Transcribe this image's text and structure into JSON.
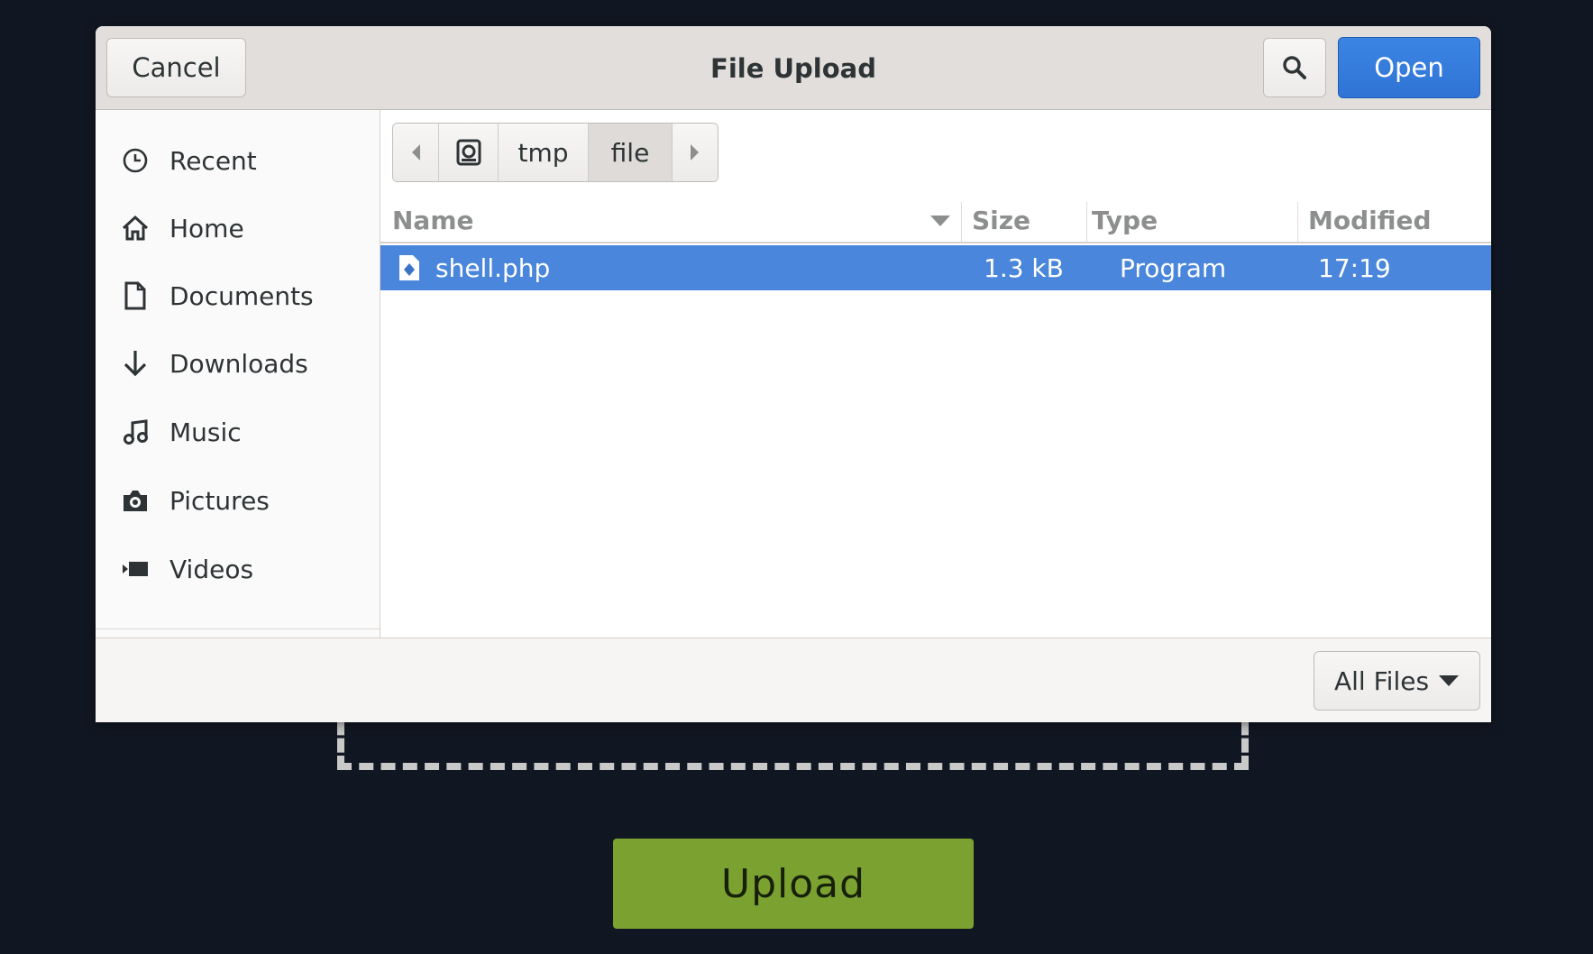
{
  "page": {
    "upload_button": "Upload"
  },
  "dialog": {
    "title": "File Upload",
    "cancel_label": "Cancel",
    "open_label": "Open",
    "sidebar": {
      "items": [
        {
          "label": "Recent",
          "icon": "clock-icon"
        },
        {
          "label": "Home",
          "icon": "home-icon"
        },
        {
          "label": "Documents",
          "icon": "document-icon"
        },
        {
          "label": "Downloads",
          "icon": "download-arrow-icon"
        },
        {
          "label": "Music",
          "icon": "music-note-icon"
        },
        {
          "label": "Pictures",
          "icon": "camera-icon"
        },
        {
          "label": "Videos",
          "icon": "video-camera-icon"
        }
      ]
    },
    "pathbar": {
      "segments": [
        "tmp",
        "file"
      ],
      "active_segment": "file"
    },
    "columns": {
      "name": "Name",
      "size": "Size",
      "type": "Type",
      "modified": "Modified"
    },
    "files": [
      {
        "name": "shell.php",
        "size": "1.3 kB",
        "type": "Program",
        "modified": "17:19",
        "selected": true
      }
    ],
    "filter": {
      "selected": "All Files"
    },
    "colors": {
      "accent": "#3584e4",
      "selection": "#4a86db",
      "upload": "#7ba230"
    }
  }
}
